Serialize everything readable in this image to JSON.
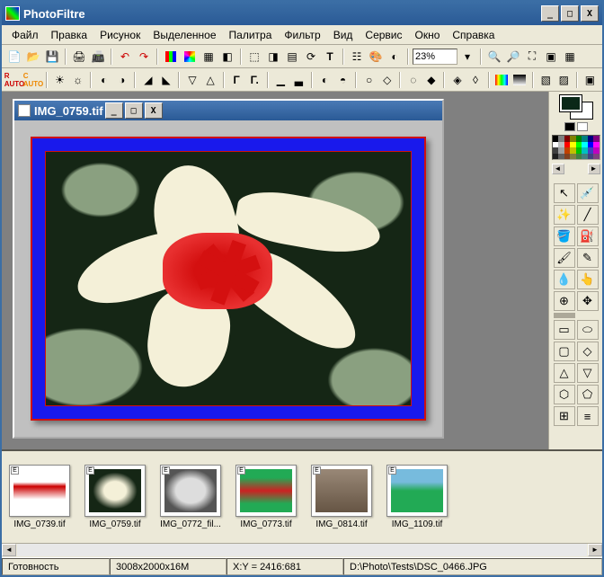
{
  "app": {
    "title": "PhotoFiltre"
  },
  "window_controls": {
    "min": "_",
    "max": "□",
    "close": "X"
  },
  "menu": [
    "Файл",
    "Правка",
    "Рисунок",
    "Выделенное",
    "Палитра",
    "Фильтр",
    "Вид",
    "Сервис",
    "Окно",
    "Справка"
  ],
  "zoom": "23%",
  "document": {
    "title": "IMG_0759.tif"
  },
  "thumbnails": [
    {
      "label": "IMG_0739.tif",
      "bg": "linear-gradient(#fff 30%,#c00 40%,#fff 70%)"
    },
    {
      "label": "IMG_0759.tif",
      "bg": "linear-gradient(#1919ec,#1919ec)",
      "inner": "radial-gradient(#f4f0d8 30%,#152615 60%)"
    },
    {
      "label": "IMG_0772_fil...",
      "bg": "radial-gradient(#ddd 40%,#555 70%)"
    },
    {
      "label": "IMG_0773.tif",
      "bg": "linear-gradient(#2a5 20%,#c22 50%,#2a5 80%)"
    },
    {
      "label": "IMG_0814.tif",
      "bg": "linear-gradient(#987,#654)"
    },
    {
      "label": "IMG_1109.tif",
      "bg": "linear-gradient(#7bd 30%,#2a5 50%)"
    }
  ],
  "palette_colors": [
    "#000",
    "#7f7f7f",
    "#800000",
    "#808000",
    "#008000",
    "#008080",
    "#000080",
    "#800080",
    "#fff",
    "#c0c0c0",
    "#ff0000",
    "#ffff00",
    "#00ff00",
    "#00ffff",
    "#0000ff",
    "#ff00ff",
    "#404040",
    "#a0a0a0",
    "#c04000",
    "#c0c000",
    "#00c000",
    "#00c0c0",
    "#4040c0",
    "#c000c0",
    "#202020",
    "#606060",
    "#804020",
    "#808040",
    "#408040",
    "#408080",
    "#404080",
    "#804080"
  ],
  "status": {
    "ready": "Готовность",
    "dims": "3008x2000x16M",
    "coords": "X:Y = 2416:681",
    "path": "D:\\Photo\\Tests\\DSC_0466.JPG"
  },
  "foreground_color": "#0a2818",
  "background_color": "#ffffff"
}
